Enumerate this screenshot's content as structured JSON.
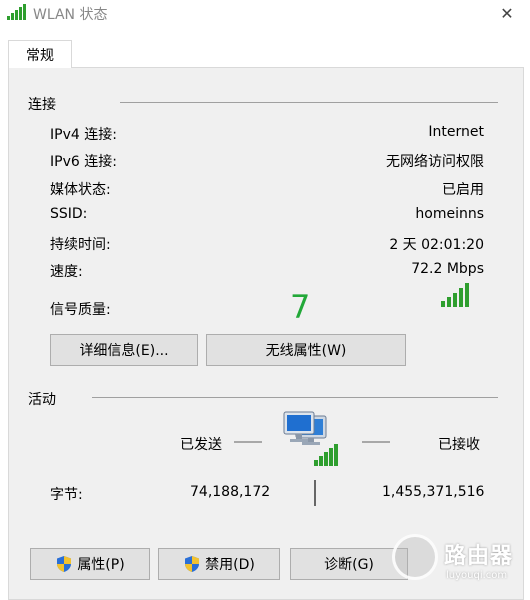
{
  "window": {
    "title": "WLAN 状态",
    "close_glyph": "✕"
  },
  "tabs": [
    {
      "label": "常规"
    }
  ],
  "connection": {
    "section_title": "连接",
    "rows": [
      {
        "label": "IPv4 连接:",
        "value": "Internet"
      },
      {
        "label": "IPv6 连接:",
        "value": "无网络访问权限"
      },
      {
        "label": "媒体状态:",
        "value": "已启用"
      },
      {
        "label": "SSID:",
        "value": "homeinns"
      },
      {
        "label": "持续时间:",
        "value": "2 天 02:01:20"
      },
      {
        "label": "速度:",
        "value": "72.2 Mbps"
      }
    ],
    "signal_label": "信号质量:",
    "signal_annotation": "7",
    "signal_bars_filled": 5,
    "signal_bars_total": 5,
    "details_button": "详细信息(E)...",
    "wireless_props_button": "无线属性(W)"
  },
  "activity": {
    "section_title": "活动",
    "sent_label": "已发送",
    "received_label": "已接收",
    "bytes_label": "字节:",
    "bytes_sent": "74,188,172",
    "bytes_received": "1,455,371,516"
  },
  "buttons": {
    "properties": "属性(P)",
    "disable": "禁用(D)",
    "diagnose": "诊断(G)"
  },
  "watermark": {
    "text": "路由器",
    "url": "luyouqi.com"
  },
  "colors": {
    "signal_green": "#2e9e2e",
    "annotation_green": "#22a838",
    "panel_bg": "#f0f0f0",
    "button_bg": "#e1e1e1"
  }
}
